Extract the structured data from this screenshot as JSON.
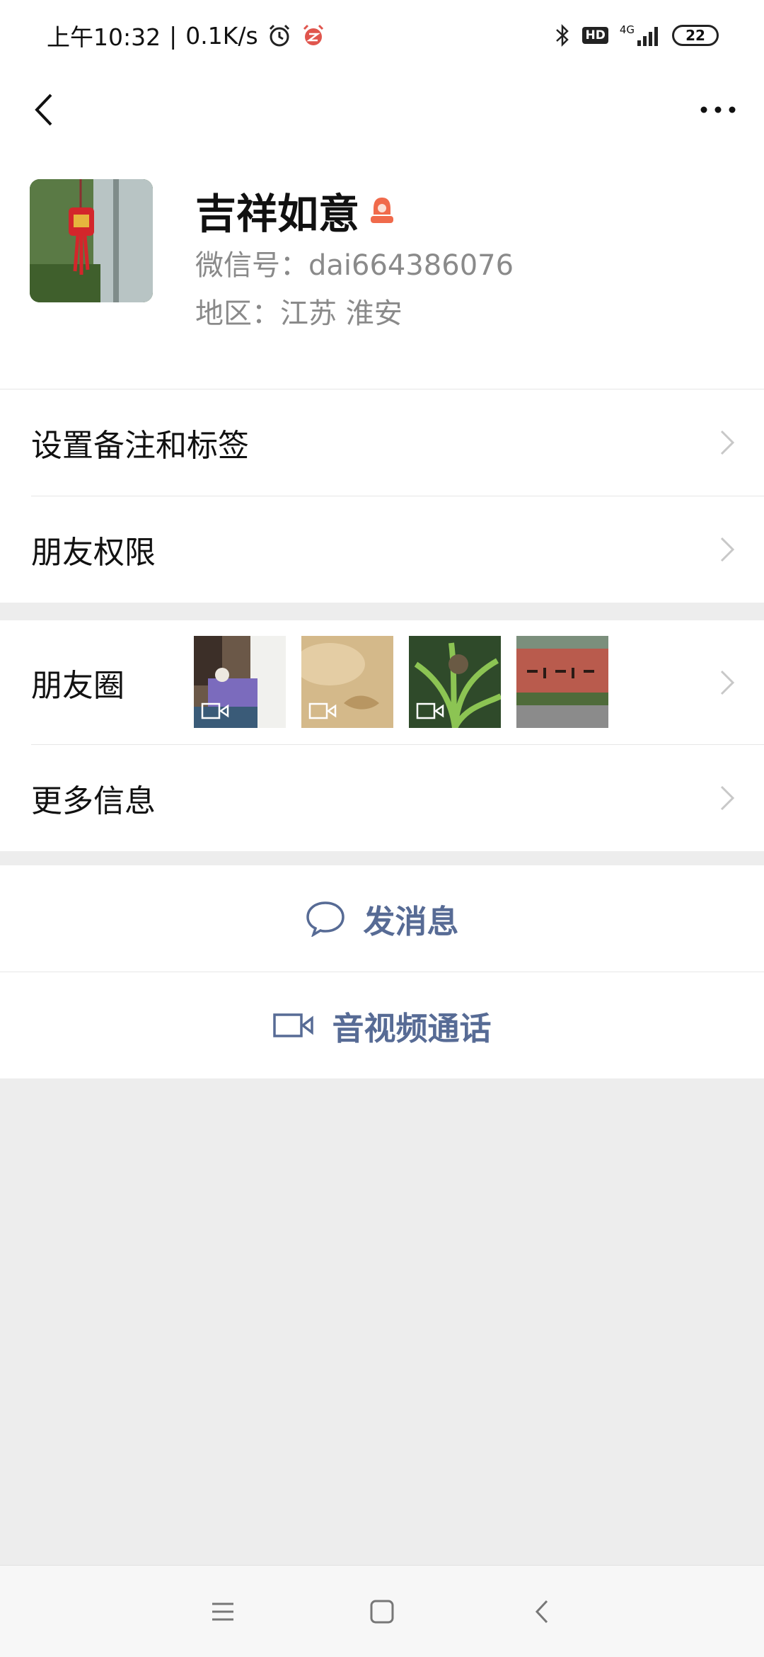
{
  "status_bar": {
    "time": "上午10:32",
    "separator": "|",
    "speed": "0.1K/s",
    "icons": [
      "alarm-icon",
      "notification-icon",
      "bluetooth-icon",
      "hd-icon",
      "signal-icon",
      "battery-icon"
    ],
    "hd": "HD",
    "network": "4G",
    "battery": "22"
  },
  "profile": {
    "nickname": "吉祥如意",
    "wechat_id": "微信号：dai664386076",
    "region": "地区：江苏  淮安",
    "gender_icon": "female-icon"
  },
  "group1": {
    "remark_label": "设置备注和标签",
    "permission_label": "朋友权限"
  },
  "group2": {
    "moments_label": "朋友圈",
    "more_info_label": "更多信息"
  },
  "actions": {
    "message_label": "发消息",
    "call_label": "音视频通话"
  },
  "colors": {
    "link": "#576b95",
    "female": "#f06a4b",
    "background": "#ededed"
  }
}
